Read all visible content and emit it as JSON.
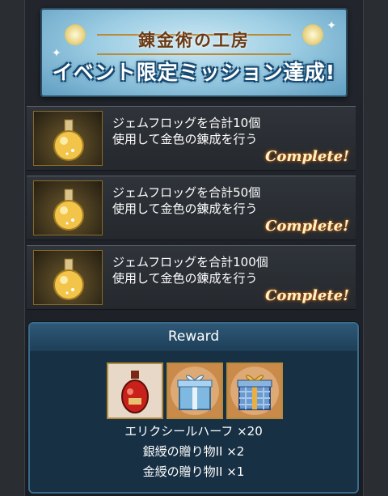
{
  "banner": {
    "title": "錬金術の工房",
    "subtitle": "イベント限定ミッション達成!"
  },
  "missions": [
    {
      "line1": "ジェムフロッグを合計10個",
      "line2": "使用して金色の錬成を行う",
      "status": "Complete!"
    },
    {
      "line1": "ジェムフロッグを合計50個",
      "line2": "使用して金色の錬成を行う",
      "status": "Complete!"
    },
    {
      "line1": "ジェムフロッグを合計100個",
      "line2": "使用して金色の錬成を行う",
      "status": "Complete!"
    }
  ],
  "reward": {
    "header": "Reward",
    "items": [
      {
        "icon": "elixir-bottle-icon",
        "text": "エリクシールハーフ ×20"
      },
      {
        "icon": "silver-gift-icon",
        "text": "銀綬の贈り物II ×2"
      },
      {
        "icon": "gold-gift-icon",
        "text": "金綬の贈り物II ×1"
      }
    ]
  },
  "colors": {
    "complete_glow": "#d26a10",
    "banner_blue": "#9ccde3",
    "reward_panel": "#173044"
  }
}
